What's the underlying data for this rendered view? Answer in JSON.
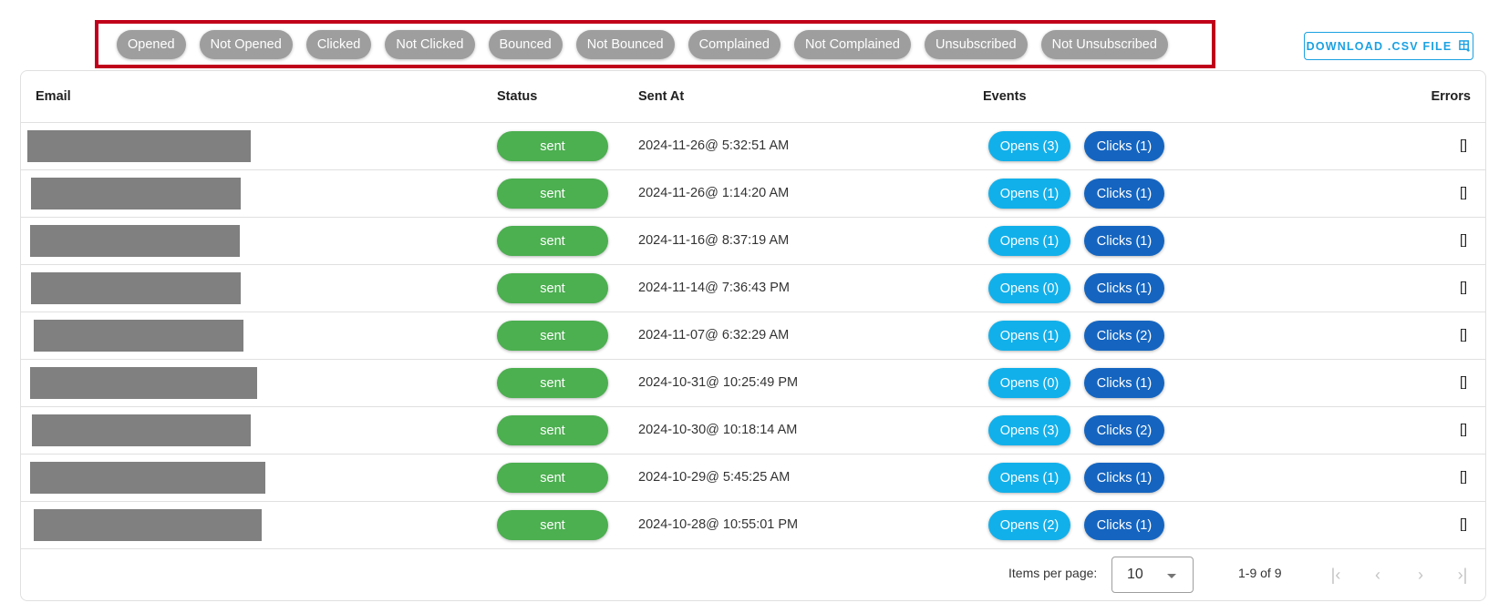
{
  "filters": [
    "Opened",
    "Not Opened",
    "Clicked",
    "Not Clicked",
    "Bounced",
    "Not Bounced",
    "Complained",
    "Not Complained",
    "Unsubscribed",
    "Not Unsubscribed"
  ],
  "download_button": {
    "label": "DOWNLOAD .CSV FILE",
    "icon": "table-download-icon"
  },
  "table": {
    "columns": {
      "email": "Email",
      "status": "Status",
      "sent_at": "Sent At",
      "events": "Events",
      "errors": "Errors"
    },
    "rows": [
      {
        "email": "[redacted]",
        "status": "sent",
        "sent_at": "2024-11-26@ 5:32:51 AM",
        "opens": "Opens (3)",
        "clicks": "Clicks (1)",
        "errors": "[]"
      },
      {
        "email": "[redacted]",
        "status": "sent",
        "sent_at": "2024-11-26@ 1:14:20 AM",
        "opens": "Opens (1)",
        "clicks": "Clicks (1)",
        "errors": "[]"
      },
      {
        "email": "[redacted]",
        "status": "sent",
        "sent_at": "2024-11-16@ 8:37:19 AM",
        "opens": "Opens (1)",
        "clicks": "Clicks (1)",
        "errors": "[]"
      },
      {
        "email": "[redacted]",
        "status": "sent",
        "sent_at": "2024-11-14@ 7:36:43 PM",
        "opens": "Opens (0)",
        "clicks": "Clicks (1)",
        "errors": "[]"
      },
      {
        "email": "[redacted]",
        "status": "sent",
        "sent_at": "2024-11-07@ 6:32:29 AM",
        "opens": "Opens (1)",
        "clicks": "Clicks (2)",
        "errors": "[]"
      },
      {
        "email": "[redacted]",
        "status": "sent",
        "sent_at": "2024-10-31@ 10:25:49 PM",
        "opens": "Opens (0)",
        "clicks": "Clicks (1)",
        "errors": "[]"
      },
      {
        "email": "[redacted]",
        "status": "sent",
        "sent_at": "2024-10-30@ 10:18:14 AM",
        "opens": "Opens (3)",
        "clicks": "Clicks (2)",
        "errors": "[]"
      },
      {
        "email": "[redacted]",
        "status": "sent",
        "sent_at": "2024-10-29@ 5:45:25 AM",
        "opens": "Opens (1)",
        "clicks": "Clicks (1)",
        "errors": "[]"
      },
      {
        "email": "[redacted]",
        "status": "sent",
        "sent_at": "2024-10-28@ 10:55:01 PM",
        "opens": "Opens (2)",
        "clicks": "Clicks (1)",
        "errors": "[]"
      }
    ]
  },
  "paginator": {
    "items_per_page_label": "Items per page:",
    "items_per_page": "10",
    "range": "1-9 of 9",
    "first_icon": "first-page-icon",
    "prev_icon": "chevron-left-icon",
    "next_icon": "chevron-right-icon",
    "last_icon": "last-page-icon"
  },
  "colors": {
    "filter_border": "#c0001a",
    "filter_chip": "#9e9e9e",
    "accent": "#1ba1e2",
    "status_sent": "#4caf50",
    "opens": "#12b0ea",
    "clicks": "#1565c0"
  }
}
